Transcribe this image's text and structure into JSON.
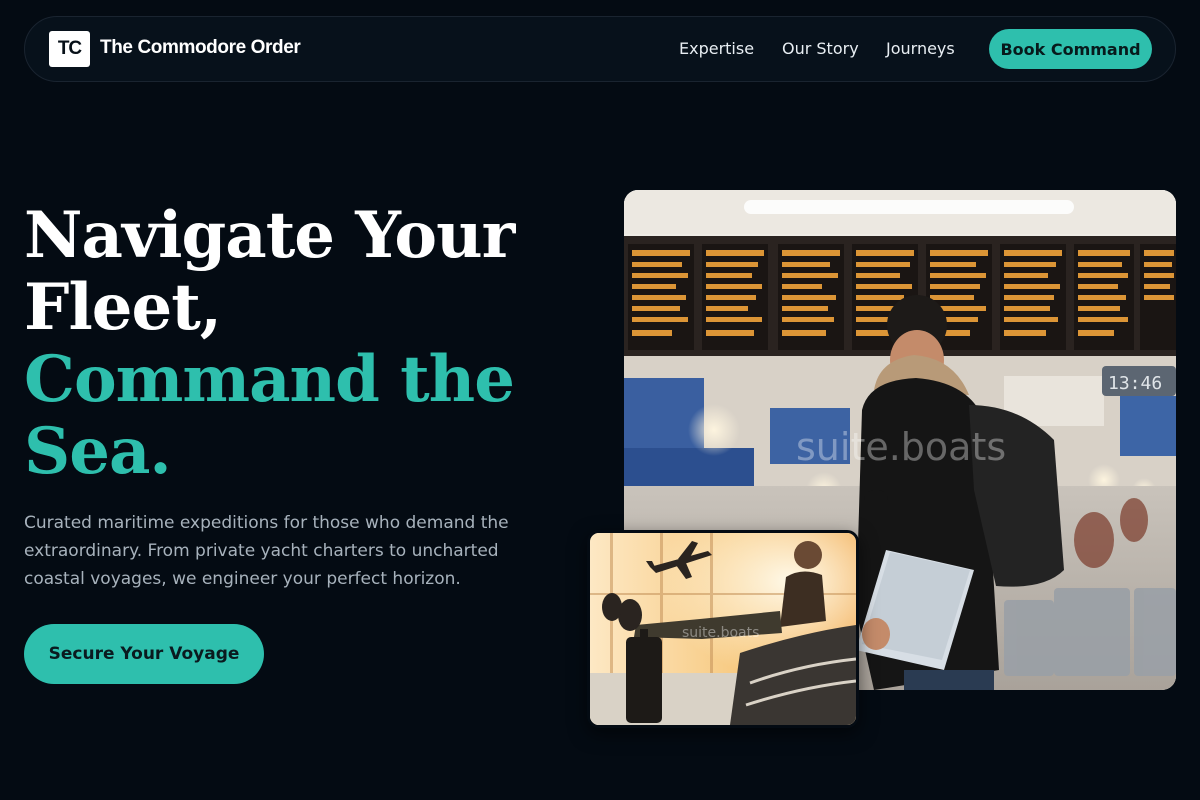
{
  "nav": {
    "logo_initials": "TC",
    "brand_name": "The Commodore Order",
    "links": [
      "Expertise",
      "Our Story",
      "Journeys"
    ],
    "cta_label": "Book Command"
  },
  "hero": {
    "headline_lines": [
      "Navigate Your",
      "Fleet,"
    ],
    "headline_accent_lines": [
      "Command the",
      "Sea."
    ],
    "lead": "Curated maritime expeditions for those who demand the extraordinary. From private yacht charters to uncharted coastal voyages, we engineer your perfect horizon.",
    "cta_label": "Secure Your Voyage"
  },
  "media": {
    "main_photo_watermark": "suite.boats",
    "main_photo_board_clock": "13:46",
    "thumb_photo_watermark": "suite.boats"
  },
  "colors": {
    "background": "#040b13",
    "accent": "#2ebfad",
    "text_primary": "#ffffff",
    "text_muted": "#a7b2bc"
  },
  "icons": {
    "logo": "tc-monogram-icon",
    "main_photo": "traveler-at-airport-departure-board",
    "thumb_photo": "traveler-resting-airport-lounge-with-airplane"
  }
}
